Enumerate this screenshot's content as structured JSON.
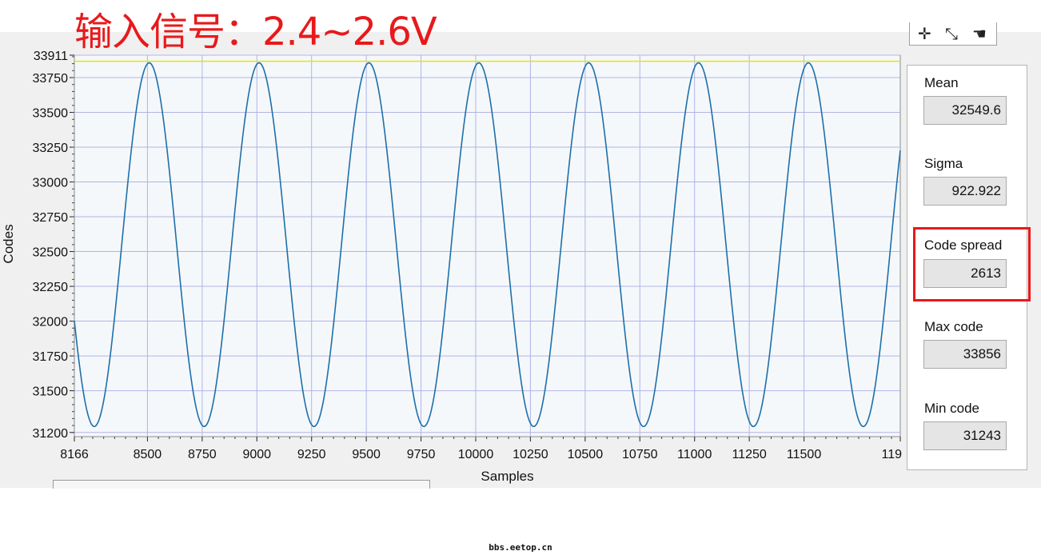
{
  "annotation": "输入信号：2.4~2.6V",
  "toolbar": {
    "icons": [
      "crosshair-icon",
      "zoom-icon",
      "pan-hand-icon"
    ]
  },
  "chart_data": {
    "type": "line",
    "xlabel": "Samples",
    "ylabel": "Codes",
    "xlim": [
      8166,
      11900
    ],
    "ylim": [
      31200,
      33911
    ],
    "x_ticks": [
      "8166",
      "8500",
      "8750",
      "9000",
      "9250",
      "9500",
      "9750",
      "10000",
      "10250",
      "10500",
      "10750",
      "11000",
      "11250",
      "11500",
      "119"
    ],
    "y_ticks": [
      "33911",
      "33750",
      "33500",
      "33250",
      "33000",
      "32750",
      "32500",
      "32250",
      "32000",
      "31750",
      "31500",
      "31200"
    ],
    "series": [
      {
        "color": "#1f6fa8",
        "waveform": "sine",
        "max": 33856,
        "min": 31243,
        "period_samples": 502,
        "first_peak_sample": 8508
      }
    ],
    "reference_line": {
      "y": 33856,
      "color": "#e6e600"
    },
    "grid": true,
    "colors": {
      "plot_bg": "#f4f8fb",
      "grid": "#b3b3e6"
    }
  },
  "stats": [
    {
      "label": "Mean",
      "value": "32549.6"
    },
    {
      "label": "Sigma",
      "value": "922.922"
    },
    {
      "label": "Code spread",
      "value": "2613"
    },
    {
      "label": "Max code",
      "value": "33856"
    },
    {
      "label": "Min code",
      "value": "31243"
    }
  ],
  "watermark": "bbs.eetop.cn"
}
